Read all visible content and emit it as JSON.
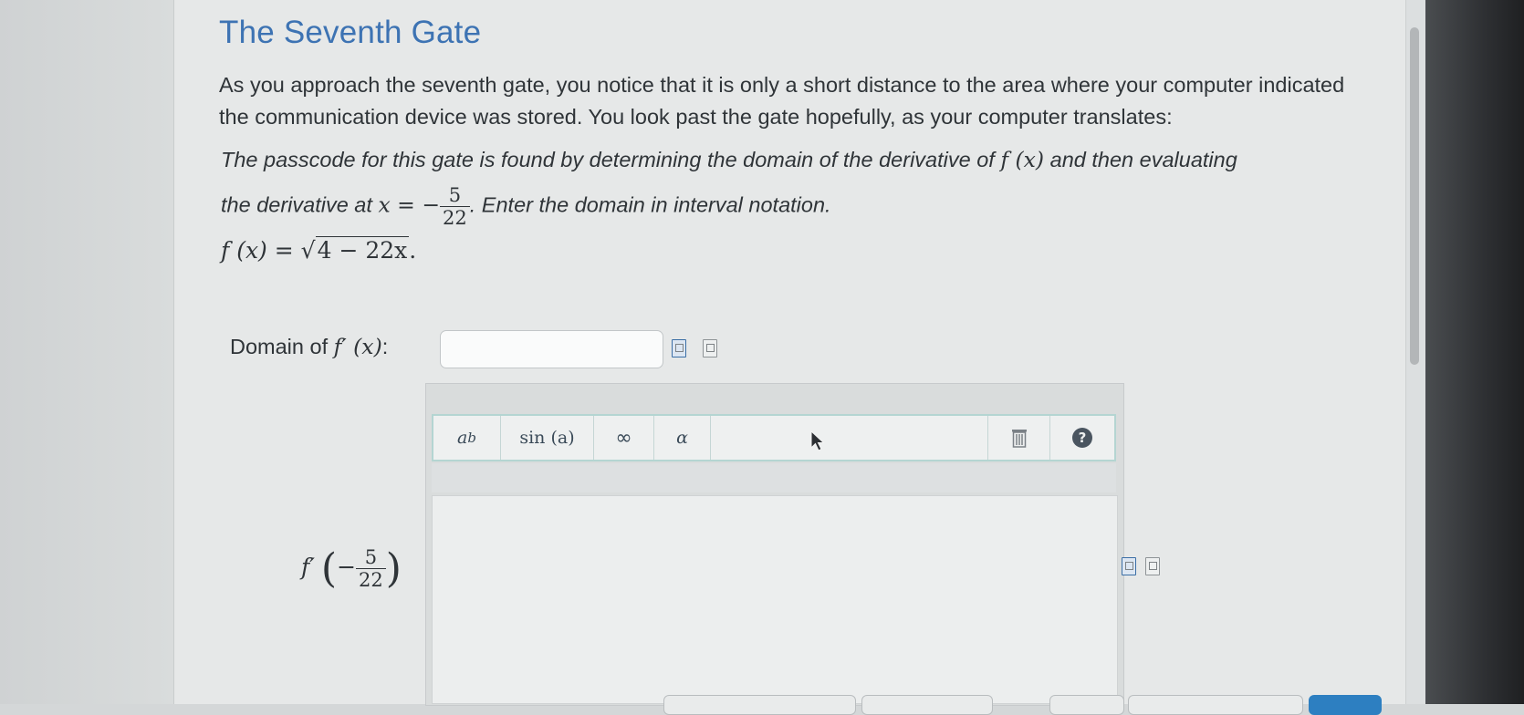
{
  "page": {
    "title": "The Seventh Gate",
    "intro": "As you approach the seventh gate, you notice that it is only a short distance to the area where your computer indicated the communication device was stored. You look past the gate hopefully, as your computer translates:",
    "prompt_a": "The passcode for this gate is found by determining the domain of the derivative of",
    "prompt_fx": "f (x)",
    "prompt_b": "and then evaluating",
    "prompt_c": "the derivative at",
    "prompt_x_eq": "x = −",
    "prompt_frac_num": "5",
    "prompt_frac_den": "22",
    "prompt_d": ". Enter the domain in interval notation.",
    "func_lhs": "f (x) = ",
    "func_sqrt_sign": "√",
    "func_radicand": "4 − 22x",
    "func_end": "."
  },
  "question_domain": {
    "label_text": "Domain of",
    "label_math": "f′ (x)",
    "label_colon": ":",
    "value": ""
  },
  "toolbar": {
    "power_base": "a",
    "power_exp": "b",
    "sin_label": "sin (a)",
    "infinity_label": "∞",
    "alpha_label": "α",
    "help_label": "?"
  },
  "question_derivative": {
    "label_f": "f′",
    "frac_sign": "−",
    "frac_num": "5",
    "frac_den": "22"
  },
  "icons": {
    "equation_editor": "equation-editor-icon",
    "preview": "preview-icon",
    "trash": "trash-icon",
    "help": "help-icon",
    "cursor": "mouse-cursor-icon"
  },
  "colors": {
    "title": "#3d73b3",
    "toolbar_border": "#b4d5d2",
    "accent_button": "#2d7fc1"
  }
}
